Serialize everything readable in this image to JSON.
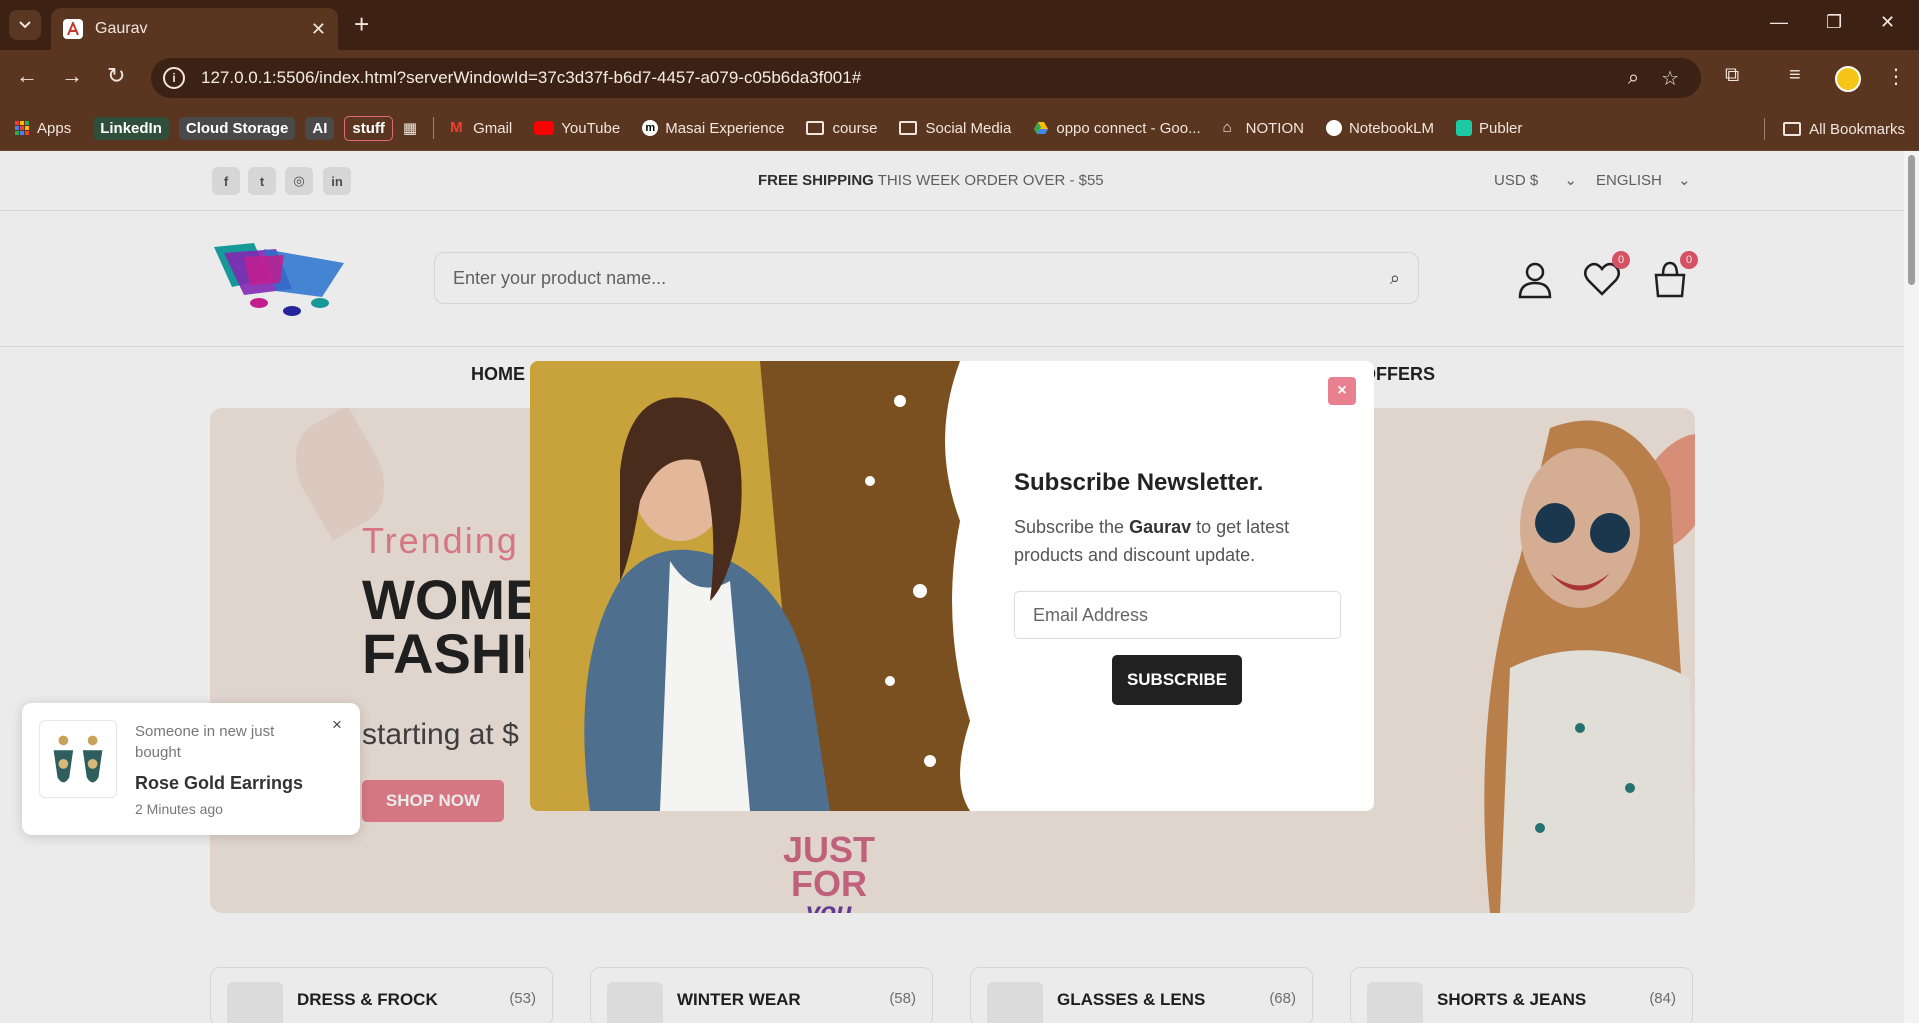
{
  "browser": {
    "tab_title": "Gaurav",
    "url": "127.0.0.1:5506/index.html?serverWindowId=37c3d37f-b6d7-4457-a079-c05b6da3f001#",
    "bookmarks": [
      {
        "label": "Apps"
      },
      {
        "label": "LinkedIn"
      },
      {
        "label": "Cloud Storage"
      },
      {
        "label": "AI"
      },
      {
        "label": "stuff"
      },
      {
        "label": "Gmail"
      },
      {
        "label": "YouTube"
      },
      {
        "label": "Masai Experience"
      },
      {
        "label": "course"
      },
      {
        "label": "Social Media"
      },
      {
        "label": "oppo connect - Goo..."
      },
      {
        "label": "NOTION"
      },
      {
        "label": "NotebookLM"
      },
      {
        "label": "Publer"
      }
    ],
    "all_bookmarks": "All Bookmarks"
  },
  "topbar": {
    "ship_bold": "FREE SHIPPING",
    "ship_rest": " THIS WEEK ORDER OVER - $55",
    "currency": "USD $",
    "language": "ENGLISH"
  },
  "header": {
    "search_placeholder": "Enter your product name...",
    "wishlist_count": "0",
    "cart_count": "0"
  },
  "nav": {
    "home": "HOME",
    "offers": "OFFERS"
  },
  "hero": {
    "subtitle": "Trending",
    "title_line1": "WOME",
    "title_line2": "FASHIO",
    "price": "starting at $",
    "button": "SHOP NOW",
    "badge_line1": "JUST",
    "badge_line2": "FOR",
    "badge_line3": "you"
  },
  "categories": [
    {
      "name": "DRESS & FROCK",
      "count": "(53)"
    },
    {
      "name": "WINTER WEAR",
      "count": "(58)"
    },
    {
      "name": "GLASSES & LENS",
      "count": "(68)"
    },
    {
      "name": "SHORTS & JEANS",
      "count": "(84)"
    }
  ],
  "modal": {
    "title": "Subscribe Newsletter.",
    "text_before": "Subscribe the ",
    "text_brand": "Gaurav",
    "text_after": " to get latest products and discount update.",
    "email_placeholder": "Email Address",
    "button": "SUBSCRIBE",
    "close": "×"
  },
  "toast": {
    "message": "Someone in new just bought",
    "product": "Rose Gold Earrings",
    "time": "2 Minutes ago",
    "close": "×"
  },
  "colors": {
    "accent_pink": "#e8808f",
    "chrome_dark": "#3d2213",
    "chrome_mid": "#5a3621"
  }
}
